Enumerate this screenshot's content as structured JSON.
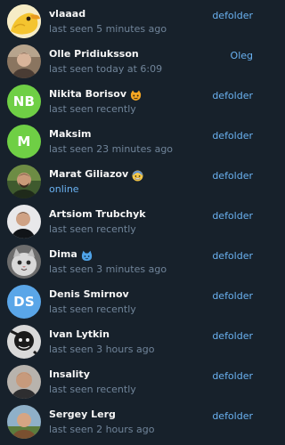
{
  "members": [
    {
      "name": "vlaaad",
      "status": "last seen 5 minutes ago",
      "role": "defolder",
      "avatar": "photo",
      "avatar_icon": "duck-photo-avatar-icon"
    },
    {
      "name": "Olle Pridiuksson",
      "status": "last seen today at 6:09",
      "role": "Oleg",
      "avatar": "photo",
      "avatar_icon": "photo-avatar-icon"
    },
    {
      "name": "Nikita Borisov",
      "status": "last seen recently",
      "role": "defolder",
      "avatar": "initials",
      "initials": "NB",
      "avatar_color": "#6fcf45",
      "emoji": "cat-face-icon"
    },
    {
      "name": "Maksim",
      "status": "last seen 23 minutes ago",
      "role": "defolder",
      "avatar": "initials",
      "initials": "M",
      "avatar_color": "#6fcf45"
    },
    {
      "name": "Marat Giliazov",
      "status": "online",
      "role": "defolder",
      "avatar": "photo",
      "avatar_icon": "photo-avatar-icon",
      "emoji": "cold-sweat-face-icon"
    },
    {
      "name": "Artsiom Trubchyk",
      "status": "last seen recently",
      "role": "defolder",
      "avatar": "photo",
      "avatar_icon": "photo-avatar-icon"
    },
    {
      "name": "Dima",
      "status": "last seen 3 minutes ago",
      "role": "defolder",
      "avatar": "photo",
      "avatar_icon": "cat-photo-avatar-icon",
      "emoji": "cat-icon"
    },
    {
      "name": "Denis Smirnov",
      "status": "last seen recently",
      "role": "defolder",
      "avatar": "initials",
      "initials": "DS",
      "avatar_color": "#5aa6e8"
    },
    {
      "name": "Ivan Lytkin",
      "status": "last seen 3 hours ago",
      "role": "defolder",
      "avatar": "photo",
      "avatar_icon": "monochrome-photo-avatar-icon"
    },
    {
      "name": "Insality",
      "status": "last seen recently",
      "role": "defolder",
      "avatar": "photo",
      "avatar_icon": "photo-avatar-icon"
    },
    {
      "name": "Sergey Lerg",
      "status": "last seen 2 hours ago",
      "role": "defolder",
      "avatar": "photo",
      "avatar_icon": "photo-avatar-icon"
    }
  ],
  "colors": {
    "background": "#17212b",
    "name": "#f5f5f5",
    "status": "#708499",
    "accent": "#6ab2f2"
  }
}
